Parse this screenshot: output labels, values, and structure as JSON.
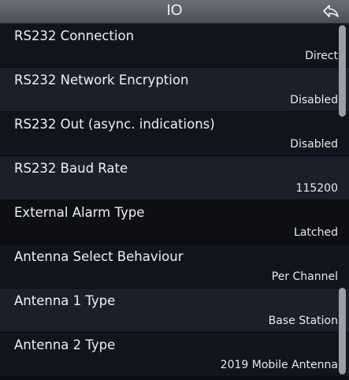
{
  "header": {
    "title": "IO",
    "back_icon": "back-arrow-icon"
  },
  "items": [
    {
      "label": "RS232 Connection",
      "value": "Direct"
    },
    {
      "label": "RS232 Network Encryption",
      "value": "Disabled"
    },
    {
      "label": "RS232 Out (async. indications)",
      "value": "Disabled"
    },
    {
      "label": "RS232 Baud Rate",
      "value": "115200"
    },
    {
      "label": "External Alarm Type",
      "value": "Latched"
    },
    {
      "label": "Antenna Select Behaviour",
      "value": "Per Channel"
    },
    {
      "label": "Antenna 1 Type",
      "value": "Base Station"
    },
    {
      "label": "Antenna 2 Type",
      "value": "2019 Mobile Antenna"
    }
  ]
}
